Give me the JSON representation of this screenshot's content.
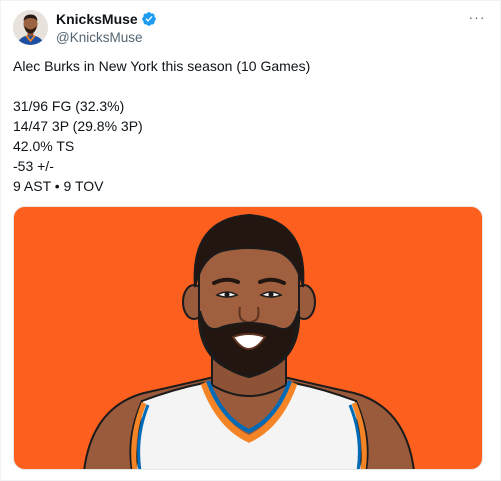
{
  "colors": {
    "accent_blue": "#1d9bf0",
    "text_primary": "#0f1419",
    "text_secondary": "#536471",
    "image_background": "#fd5f1e",
    "jersey_orange": "#f58426",
    "jersey_blue": "#006bb6"
  },
  "tweet": {
    "display_name": "KnicksMuse",
    "handle": "@KnicksMuse",
    "verified_icon": "verified-badge-icon",
    "more_icon": "more-options-icon",
    "more_glyph": "···",
    "lines": [
      "Alec Burks in New York this season (10 Games)",
      "",
      "31/96 FG (32.3%)",
      "14/47 3P (29.8% 3P)",
      "42.0% TS",
      "-53 +/-",
      "9 AST • 9 TOV"
    ]
  }
}
